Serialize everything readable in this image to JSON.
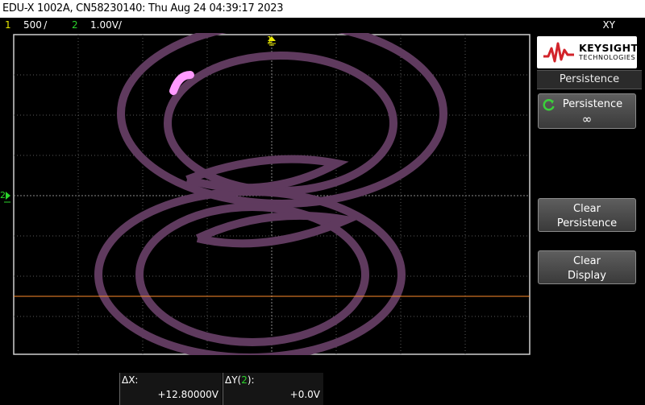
{
  "title_bar": {
    "text": "EDU-X 1002A, CN58230140: Thu Aug 24 04:39:17 2023"
  },
  "channels": {
    "ch1_number": "1",
    "ch1_scale": "500 /",
    "ch2_number": "2",
    "ch2_scale": "1.00V/",
    "mode": "XY"
  },
  "markers": {
    "ch1_marker": "1",
    "ch2_marker": "2"
  },
  "colors": {
    "trace": "#5f3a5e",
    "trace_bright": "#ff9aff",
    "ch1": "#e8e800",
    "ch2": "#2bd42b",
    "cursor": "#ff8c2a",
    "grid": "#5a5a5a"
  },
  "logo": {
    "brand": "KEYSIGHT",
    "sub": "TECHNOLOGIES"
  },
  "menu": {
    "title": "Persistence",
    "softkeys": [
      {
        "line1": "Persistence",
        "line2": "∞"
      },
      {
        "line1": "Clear",
        "line2": "Persistence"
      },
      {
        "line1": "Clear",
        "line2": "Display"
      }
    ]
  },
  "measurements": {
    "dx_label": "ΔX:",
    "dx_value": "+12.80000V",
    "dy_label_prefix": "ΔY(",
    "dy_label_channel": "2",
    "dy_label_suffix": "):",
    "dy_value": "+0.0V"
  }
}
